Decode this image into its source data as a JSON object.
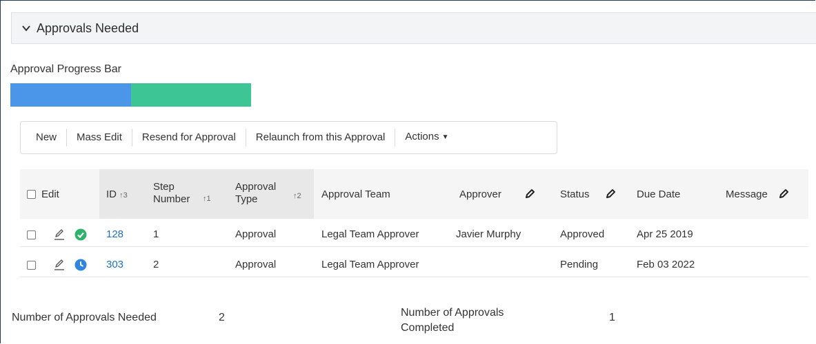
{
  "section": {
    "title": "Approvals Needed",
    "expanded_icon": "chevron-down-icon"
  },
  "progress": {
    "label": "Approval Progress Bar",
    "approved_fraction": 0.5,
    "pending_fraction": 0.5,
    "colors": {
      "approved": "#4b96e8",
      "pending": "#3ec596"
    }
  },
  "toolbar": {
    "buttons": [
      "New",
      "Mass Edit",
      "Resend for Approval",
      "Relaunch from this Approval"
    ],
    "actions_label": "Actions"
  },
  "grid": {
    "headers": {
      "edit": "Edit",
      "id": "ID",
      "id_sort": "↑3",
      "step_number_line1": "Step",
      "step_number_line2": "Number",
      "step_sort": "↑1",
      "approval_type_line1": "Approval",
      "approval_type_line2": "Type",
      "type_sort": "↑2",
      "approval_team": "Approval Team",
      "approver": "Approver",
      "status": "Status",
      "due_date": "Due Date",
      "message": "Message"
    },
    "rows": [
      {
        "id": "128",
        "step": "1",
        "type": "Approval",
        "team": "Legal Team Approver",
        "approver": "Javier Murphy",
        "status": "Approved",
        "due": "Apr 25 2019",
        "message": "",
        "status_icon": "check-circle-icon"
      },
      {
        "id": "303",
        "step": "2",
        "type": "Approval",
        "team": "Legal Team Approver",
        "approver": "",
        "status": "Pending",
        "due": "Feb 03 2022",
        "message": "",
        "status_icon": "clock-icon"
      }
    ]
  },
  "summary": {
    "needed_label": "Number of Approvals Needed",
    "needed_value": "2",
    "completed_label_line1": "Number of Approvals",
    "completed_label_line2": "Completed",
    "completed_value": "1"
  },
  "colors": {
    "link": "#1b6fc2",
    "approved_icon": "#2fb36a",
    "pending_icon": "#2f86e0"
  }
}
